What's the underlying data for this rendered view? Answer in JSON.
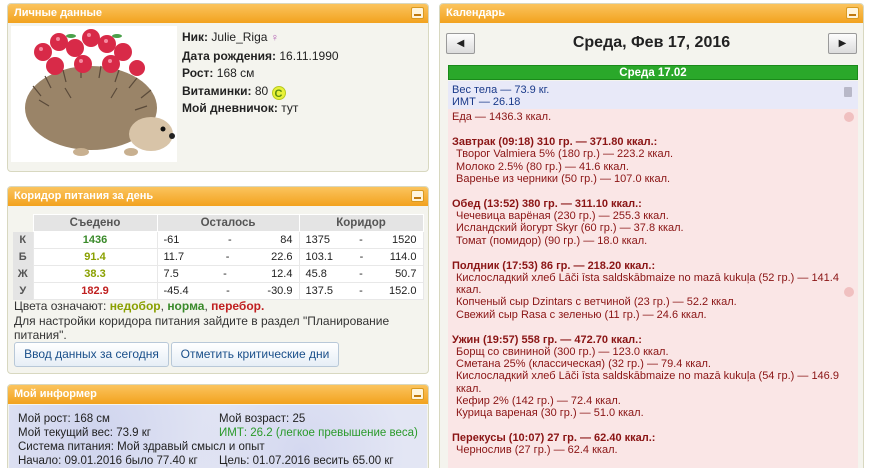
{
  "personal": {
    "title": "Личные данные",
    "nick_label": "Ник:",
    "nick": "Julie_Riga",
    "gender_symbol": "♀",
    "birth_label": "Дата рождения:",
    "birth": "16.11.1990",
    "height_label": "Рост:",
    "height": "168 см",
    "vit_label": "Витаминки:",
    "vit": "80",
    "vit_icon": "C",
    "diary_label": "Мой дневничок:",
    "diary": "тут"
  },
  "corridor": {
    "title": "Коридор питания за день",
    "headers": [
      "Съедено",
      "Осталось",
      "Коридор"
    ],
    "rows": [
      {
        "label": "К",
        "eaten": "1436",
        "left_min": "-61",
        "left_max": "84",
        "corr_min": "1375",
        "corr_max": "1520",
        "status": "green"
      },
      {
        "label": "Б",
        "eaten": "91.4",
        "left_min": "11.7",
        "left_max": "22.6",
        "corr_min": "103.1",
        "corr_max": "114.0",
        "status": "olive"
      },
      {
        "label": "Ж",
        "eaten": "38.3",
        "left_min": "7.5",
        "left_max": "12.4",
        "corr_min": "45.8",
        "corr_max": "50.7",
        "status": "olive"
      },
      {
        "label": "У",
        "eaten": "182.9",
        "left_min": "-45.4",
        "left_max": "-30.9",
        "corr_min": "137.5",
        "corr_max": "152.0",
        "status": "red"
      }
    ],
    "dash": "-",
    "legend_prefix": "Цвета означают:",
    "legend_under": "недобор",
    "legend_norm": "норма",
    "legend_over": "перебор.",
    "hint": "Для настройки коридора питания зайдите в раздел \"Планирование питания\".",
    "btn_today": "Ввод данных за сегодня",
    "btn_critical": "Отметить критические дни"
  },
  "info": {
    "title": "Мой информер",
    "my_height": "Мой рост: 168 см",
    "my_age": "Мой возраст: 25",
    "my_weight": "Мой текущий вес: 73.9 кг",
    "bmi": "ИМТ: 26.2 (легкое превышение веса)",
    "system": "Система питания: Мой здравый смысл и опыт",
    "start": "Начало: 09.01.2016 было 77.40 кг",
    "goal": "Цель: 01.07.2016 весить 65.00 кг"
  },
  "calendar": {
    "title": "Календарь",
    "prev_icon": "◀",
    "next_icon": "▶",
    "date_title": "Среда, Фев 17, 2016",
    "day_bar": "Среда 17.02",
    "weight_line": "Вес тела — 73.9 кг.",
    "bmi_line": "ИМТ — 26.18",
    "food_total": "Еда — 1436.3 ккал.",
    "meals": [
      {
        "head": "Завтрак (09:18) 310 гр. — 371.80 ккал.:",
        "items": [
          "Творог Valmiera 5% (180 гр.) — 223.2 ккал.",
          "Молоко 2.5% (80 гр.) — 41.6 ккал.",
          "Варенье из черники (50 гр.) — 107.0 ккал."
        ]
      },
      {
        "head": "Обед (13:52) 380 гр. — 311.10 ккал.:",
        "items": [
          "Чечевица варёная (230 гр.) — 255.3 ккал.",
          "Исландский йогурт Skyr (60 гр.) — 37.8 ккал.",
          "Томат (помидор) (90 гр.) — 18.0 ккал."
        ]
      },
      {
        "head": "Полдник (17:53) 86 гр. — 218.20 ккал.:",
        "items": [
          "Кислосладкий хлеб Lāči īsta saldskābmaize no mazā kukuļa (52 гр.) — 141.4 ккал.",
          "Копченый сыр Dzintars с ветчиной (23 гр.) — 52.2 ккал.",
          "Свежий сыр Rasa с зеленью (11 гр.) — 24.6 ккал."
        ]
      },
      {
        "head": "Ужин (19:57) 558 гр. — 472.70 ккал.:",
        "items": [
          "Борщ со свининой (300 гр.) — 123.0 ккал.",
          "Сметана 25% (классическая) (32 гр.) — 79.4 ккал.",
          "Кислосладкий хлеб Lāči īsta saldskābmaize no mazā kukuļa (54 гр.) — 146.9 ккал.",
          "Кефир 2% (142 гр.) — 72.4 ккал.",
          "Курица вареная (30 гр.) — 51.0 ккал."
        ]
      },
      {
        "head": "Перекусы (10:07) 27 гр. — 62.40 ккал.:",
        "items": [
          "Чернослив (27 гр.) — 62.4 ккал."
        ]
      }
    ]
  },
  "icons": {
    "minimize": "minimize-icon",
    "trash": "trash-icon",
    "like": "thumb-icon",
    "avatar": "hedgehog-with-raspberries"
  },
  "colors": {
    "panel_header": "#f2a21e",
    "day_bar": "#2aa82a",
    "food_bg": "#fae6e6",
    "weight_bg": "#e8e9f8"
  }
}
